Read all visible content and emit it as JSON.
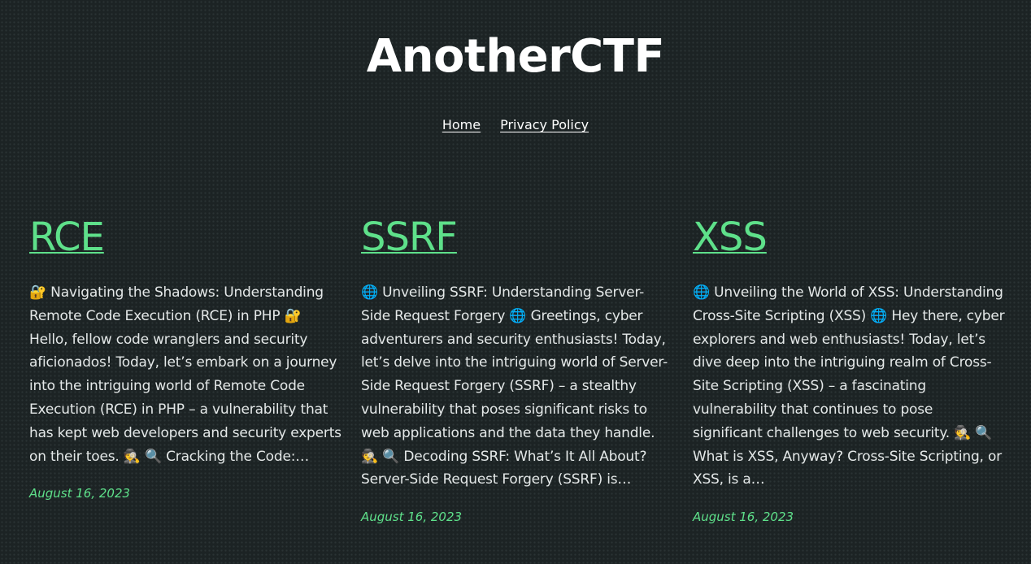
{
  "site": {
    "title": "AnotherCTF"
  },
  "nav": {
    "items": [
      {
        "label": "Home"
      },
      {
        "label": "Privacy Policy"
      }
    ]
  },
  "posts": [
    {
      "title": "RCE",
      "excerpt": "🔐 Navigating the Shadows: Understanding Remote Code Execution (RCE) in PHP 🔐 Hello, fellow code wranglers and security aficionados! Today, let’s embark on a journey into the intriguing world of Remote Code Execution (RCE) in PHP – a vulnerability that has kept web developers and security experts on their toes. 🕵️ 🔍 Cracking the Code:…",
      "date": "August 16, 2023"
    },
    {
      "title": "SSRF",
      "excerpt": "🌐 Unveiling SSRF: Understanding Server-Side Request Forgery 🌐 Greetings, cyber adventurers and security enthusiasts! Today, let’s delve into the intriguing world of Server-Side Request Forgery (SSRF) – a stealthy vulnerability that poses significant risks to web applications and the data they handle. 🕵️ 🔍 Decoding SSRF: What’s It All About? Server-Side Request Forgery (SSRF) is…",
      "date": "August 16, 2023"
    },
    {
      "title": "XSS",
      "excerpt": "🌐 Unveiling the World of XSS: Understanding Cross-Site Scripting (XSS) 🌐 Hey there, cyber explorers and web enthusiasts! Today, let’s dive deep into the intriguing realm of Cross-Site Scripting (XSS) – a fascinating vulnerability that continues to pose significant challenges to web security. 🕵️ 🔍 What is XSS, Anyway? Cross-Site Scripting, or XSS, is a…",
      "date": "August 16, 2023"
    }
  ]
}
